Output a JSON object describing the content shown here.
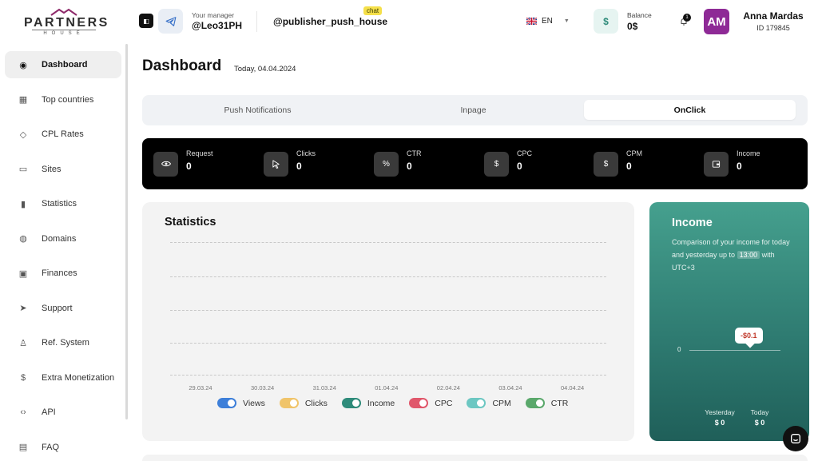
{
  "brand": {
    "name": "PARTNERS",
    "sub": "HOUSE"
  },
  "sidebar": {
    "items": [
      {
        "label": "Dashboard",
        "icon": "location-pin-icon",
        "active": true
      },
      {
        "label": "Top countries",
        "icon": "grid-icon"
      },
      {
        "label": "CPL Rates",
        "icon": "tag-icon"
      },
      {
        "label": "Sites",
        "icon": "monitor-icon"
      },
      {
        "label": "Statistics",
        "icon": "bar-chart-icon"
      },
      {
        "label": "Domains",
        "icon": "globe-icon"
      },
      {
        "label": "Finances",
        "icon": "wallet-icon"
      },
      {
        "label": "Support",
        "icon": "send-icon"
      },
      {
        "label": "Ref. System",
        "icon": "user-icon"
      },
      {
        "label": "Extra Monetization",
        "icon": "dollar-circle-icon"
      },
      {
        "label": "API",
        "icon": "code-icon"
      },
      {
        "label": "FAQ",
        "icon": "message-icon"
      }
    ]
  },
  "header": {
    "manager_label": "Your manager",
    "manager_name": "@Leo31PH",
    "channel": "@publisher_push_house",
    "chat_badge": "chat",
    "lang": "EN",
    "balance_label": "Balance",
    "balance_value": "0$",
    "balance_icon_glyph": "$",
    "notification_count": "1",
    "avatar_initials": "AM",
    "user_name": "Anna Mardas",
    "user_id": "ID 179845"
  },
  "page": {
    "title": "Dashboard",
    "date": "Today, 04.04.2024"
  },
  "tabs": [
    {
      "label": "Push Notifications",
      "active": false
    },
    {
      "label": "Inpage",
      "active": false
    },
    {
      "label": "OnClick",
      "active": true
    }
  ],
  "metrics": [
    {
      "label": "Request",
      "value": "0",
      "icon": "eye-icon",
      "glyph": ""
    },
    {
      "label": "Clicks",
      "value": "0",
      "icon": "cursor-icon",
      "glyph": ""
    },
    {
      "label": "CTR",
      "value": "0",
      "icon": "percent-icon",
      "glyph": "%"
    },
    {
      "label": "CPC",
      "value": "0",
      "icon": "dollar-icon",
      "glyph": "$"
    },
    {
      "label": "CPM",
      "value": "0",
      "icon": "dollar-icon",
      "glyph": "$"
    },
    {
      "label": "Income",
      "value": "0",
      "icon": "wallet-icon",
      "glyph": ""
    }
  ],
  "statistics": {
    "title": "Statistics",
    "x_labels": [
      "29.03.24",
      "30.03.24",
      "31.03.24",
      "01.04.24",
      "02.04.24",
      "03.04.24",
      "04.04.24"
    ],
    "legend": [
      {
        "label": "Views",
        "color": "#3d7fd9"
      },
      {
        "label": "Clicks",
        "color": "#f0c46a"
      },
      {
        "label": "Income",
        "color": "#2e8b7a"
      },
      {
        "label": "CPC",
        "color": "#e0576b"
      },
      {
        "label": "CPM",
        "color": "#6cc7c2"
      },
      {
        "label": "CTR",
        "color": "#5aa86b"
      }
    ]
  },
  "income": {
    "title": "Income",
    "desc_before": "Comparison of your income for today and yesterday up to",
    "desc_time": "13:00",
    "desc_after": "with UTC+3",
    "zero_label": "0",
    "tooltip": "-$0.1",
    "yesterday_label": "Yesterday",
    "yesterday_value": "$ 0",
    "today_label": "Today",
    "today_value": "$ 0"
  }
}
